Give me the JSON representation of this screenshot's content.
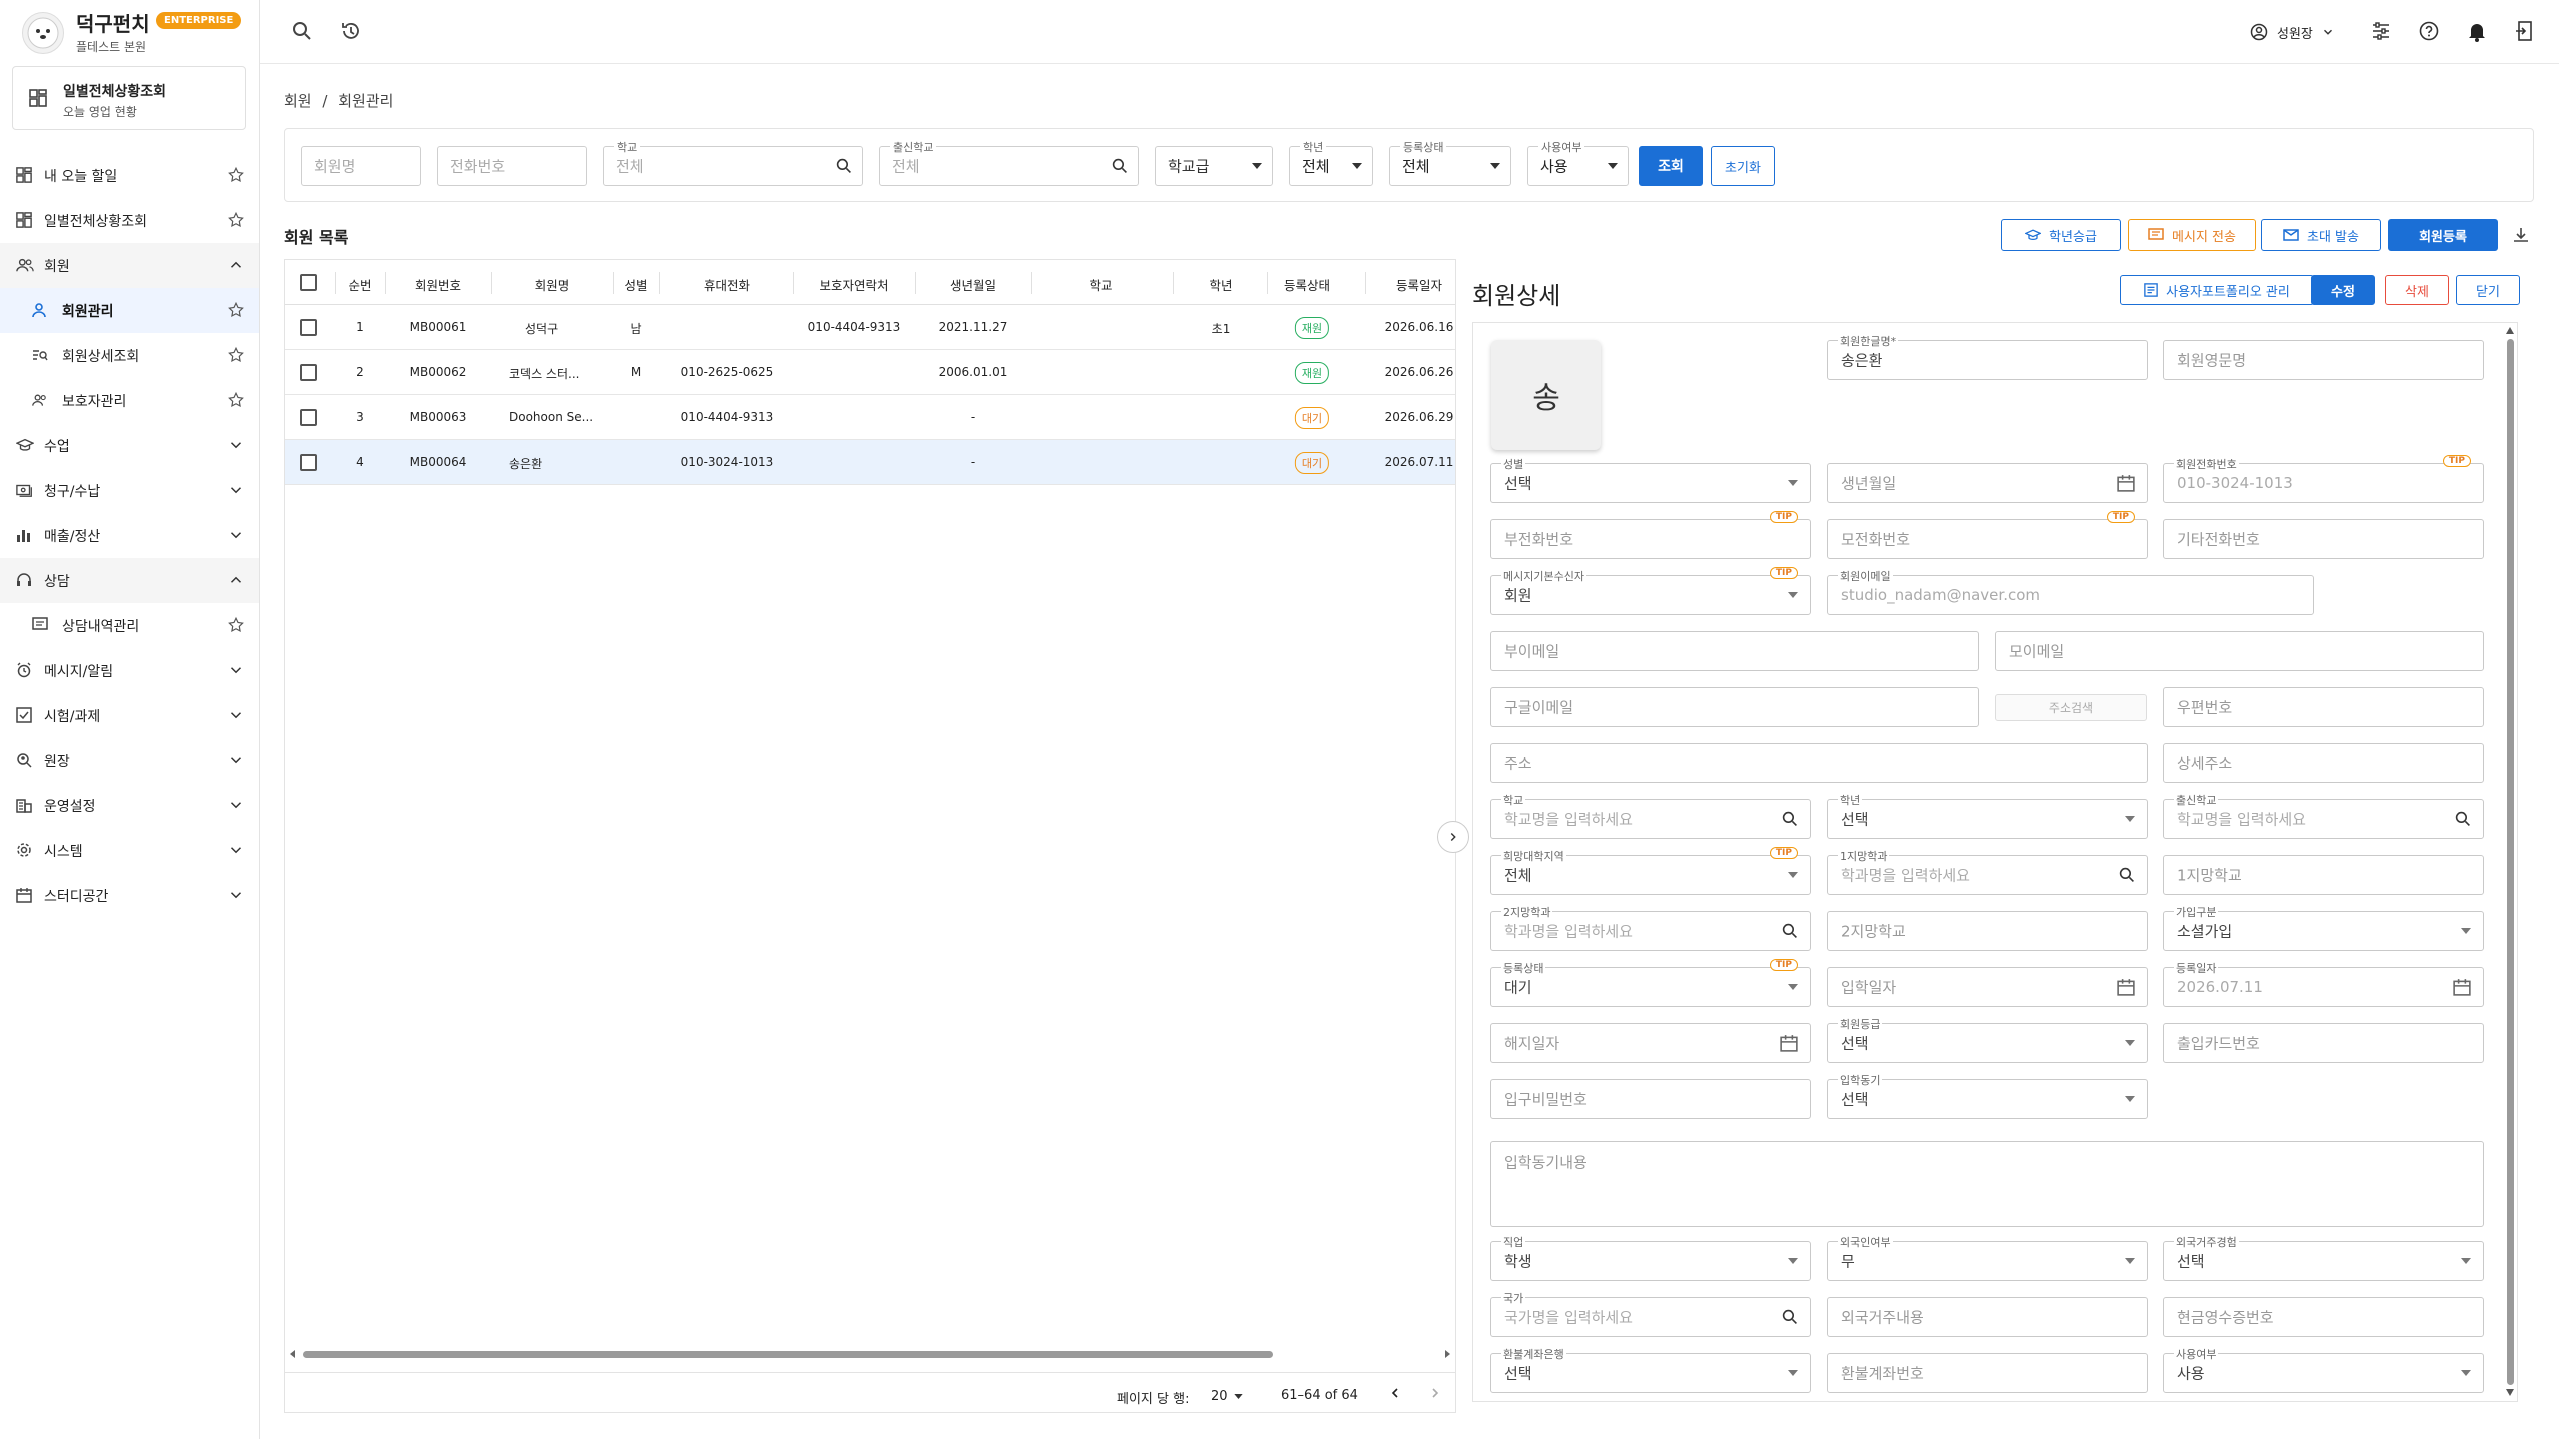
{
  "brand": {
    "name": "덕구펀치",
    "badge": "ENTERPRISE",
    "branch": "플테스트 본원"
  },
  "dashboard_card": {
    "title": "일별전체상황조회",
    "subtitle": "오늘 영업 현황"
  },
  "sidebar": {
    "items": [
      {
        "label": "내 오늘 할일"
      },
      {
        "label": "일별전체상황조회"
      },
      {
        "label": "회원"
      },
      {
        "label": "회원관리"
      },
      {
        "label": "회원상세조회"
      },
      {
        "label": "보호자관리"
      },
      {
        "label": "수업"
      },
      {
        "label": "청구/수납"
      },
      {
        "label": "매출/정산"
      },
      {
        "label": "상담"
      },
      {
        "label": "상담내역관리"
      },
      {
        "label": "메시지/알림"
      },
      {
        "label": "시험/과제"
      },
      {
        "label": "원장"
      },
      {
        "label": "운영설정"
      },
      {
        "label": "시스템"
      },
      {
        "label": "스터디공간"
      }
    ]
  },
  "topbar": {
    "user": "성원장"
  },
  "breadcrumb": {
    "root": "회원",
    "sep": "/",
    "current": "회원관리"
  },
  "filters": {
    "name_ph": "회원명",
    "phone_ph": "전화번호",
    "school_label": "학교",
    "school_ph": "전체",
    "origin_label": "출신학교",
    "origin_ph": "전체",
    "level_value": "학교급",
    "grade_label": "학년",
    "grade_value": "전체",
    "status_label": "등록상태",
    "status_value": "전체",
    "use_label": "사용여부",
    "use_value": "사용",
    "search_btn": "조회",
    "reset_btn": "초기화"
  },
  "list": {
    "title": "회원 목록",
    "actions": {
      "promote": "학년승급",
      "message": "메시지 전송",
      "invite": "초대 발송",
      "register": "회원등록"
    },
    "columns": [
      "순번",
      "회원번호",
      "회원명",
      "성별",
      "휴대전화",
      "보호자연락처",
      "생년월일",
      "학교",
      "학년",
      "등록상태",
      "등록일자"
    ],
    "rows": [
      {
        "no": "1",
        "id": "MB00061",
        "name": "성덕구",
        "gender": "남",
        "phone": "",
        "guardian": "010-4404-9313",
        "birth": "2021.11.27",
        "school": "",
        "grade": "초1",
        "status": "재원",
        "date": "2026.06.16"
      },
      {
        "no": "2",
        "id": "MB00062",
        "name": "코덱스 스터...",
        "gender": "M",
        "phone": "010-2625-0625",
        "guardian": "",
        "birth": "2006.01.01",
        "school": "",
        "grade": "",
        "status": "재원",
        "date": "2026.06.26"
      },
      {
        "no": "3",
        "id": "MB00063",
        "name": "Doohoon Se...",
        "gender": "",
        "phone": "010-4404-9313",
        "guardian": "",
        "birth": "-",
        "school": "",
        "grade": "",
        "status": "대기",
        "date": "2026.06.29"
      },
      {
        "no": "4",
        "id": "MB00064",
        "name": "송은환",
        "gender": "",
        "phone": "010-3024-1013",
        "guardian": "",
        "birth": "-",
        "school": "",
        "grade": "",
        "status": "대기",
        "date": "2026.07.11"
      }
    ],
    "pagination": {
      "per_page_label": "페이지 당 행:",
      "per_page": "20",
      "range": "61–64 of 64"
    }
  },
  "detail": {
    "title": "회원상세",
    "actions": {
      "portfolio": "사용자포트폴리오 관리",
      "edit": "수정",
      "delete": "삭제",
      "close": "닫기"
    },
    "avatar": "송",
    "tip": "TIP",
    "fields": {
      "name_kr_label": "회원한글명*",
      "name_kr": "송은환",
      "name_en_ph": "회원영문명",
      "gender_label": "성별",
      "gender": "선택",
      "birth_ph": "생년월일",
      "phone_label": "회원전화번호",
      "phone": "010-3024-1013",
      "father_phone_ph": "부전화번호",
      "mother_phone_ph": "모전화번호",
      "other_phone_ph": "기타전화번호",
      "msg_label": "메시지기본수신자",
      "msg": "회원",
      "email_label": "회원이메일",
      "email": "studio_nadam@naver.com",
      "father_email_ph": "부이메일",
      "mother_email_ph": "모이메일",
      "google_email_ph": "구글이메일",
      "addr_search": "주소검색",
      "zip_ph": "우편번호",
      "addr_ph": "주소",
      "addr_detail_ph": "상세주소",
      "school_label": "학교",
      "school_ph": "학교명을 입력하세요",
      "grade_label": "학년",
      "grade": "선택",
      "origin_label": "출신학교",
      "origin_ph": "학교명을 입력하세요",
      "region_label": "희망대학지역",
      "region": "전체",
      "major1_label": "1지망학과",
      "major1_ph": "학과명을 입력하세요",
      "school1_ph": "1지망학교",
      "major2_label": "2지망학과",
      "major2_ph": "학과명을 입력하세요",
      "school2_ph": "2지망학교",
      "join_label": "가입구분",
      "join": "소셜가입",
      "status_label": "등록상태",
      "status": "대기",
      "entry_date_ph": "입학일자",
      "reg_date_label": "등록일자",
      "reg_date": "2026.07.11",
      "leave_date_ph": "해지일자",
      "level_label": "회원등급",
      "level": "선택",
      "card_ph": "출입카드번호",
      "door_pw_ph": "입구비밀번호",
      "motive_label": "입학동기",
      "motive": "선택",
      "motive_text_ph": "입학동기내용",
      "job_label": "직업",
      "job": "학생",
      "foreign_label": "외국인여부",
      "foreign": "무",
      "abroad_label": "외국거주경험",
      "abroad": "선택",
      "country_label": "국가",
      "country_ph": "국가명을 입력하세요",
      "abroad_text_ph": "외국거주내용",
      "receipt_ph": "현금영수증번호",
      "bank_label": "환불계좌은행",
      "bank": "선택",
      "account_ph": "환불계좌번호",
      "use_label": "사용여부",
      "use": "사용"
    }
  },
  "colors": {
    "primary": "#1b6fd6",
    "orange": "#f39c12",
    "green": "#27ae60",
    "red": "#e74c3c",
    "selected_row": "#e9f2fd"
  }
}
